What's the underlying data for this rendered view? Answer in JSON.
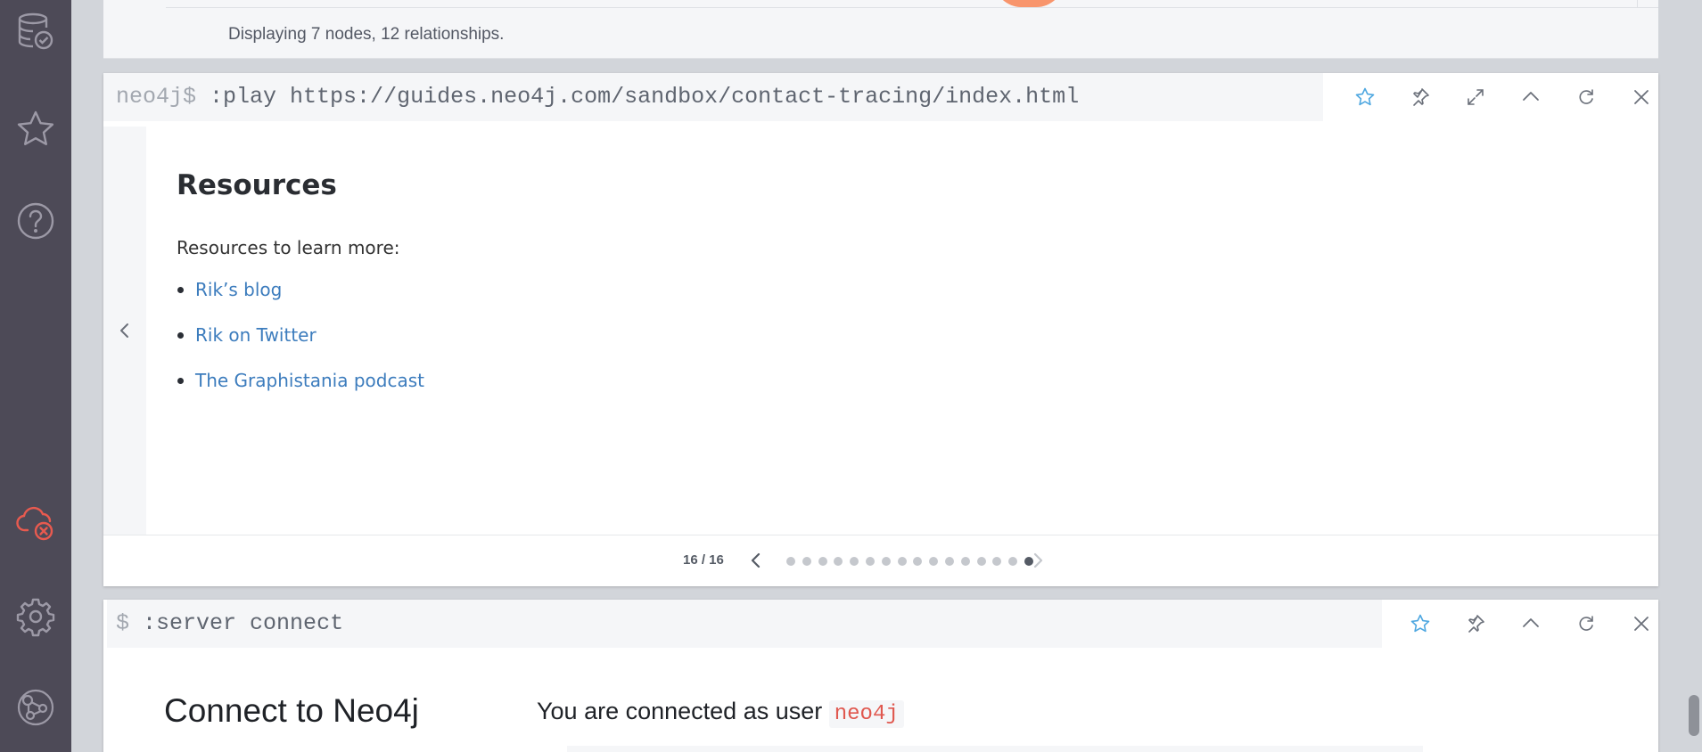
{
  "sidebar": {
    "items": [
      {
        "name": "database-icon"
      },
      {
        "name": "favorites-icon"
      },
      {
        "name": "help-icon"
      },
      {
        "name": "cloud-disconnected-icon"
      },
      {
        "name": "settings-icon"
      },
      {
        "name": "neo4j-browser-sync-icon"
      }
    ]
  },
  "top_frame": {
    "status": "Displaying 7 nodes, 12 relationships."
  },
  "play_frame": {
    "prompt": "neo4j$",
    "command": ":play https://guides.neo4j.com/sandbox/contact-tracing/index.html",
    "toolbar": [
      "star-icon",
      "pin-icon",
      "expand-icon",
      "collapse-icon",
      "rerun-icon",
      "close-icon"
    ],
    "guide": {
      "title": "Resources",
      "intro": "Resources to learn more:",
      "links": [
        "Rik’s blog",
        "Rik on Twitter",
        "The Graphistania podcast"
      ]
    },
    "pagination": {
      "counter": "16 / 16",
      "total": 16,
      "current": 16
    }
  },
  "connect_frame": {
    "prompt": "$",
    "command": ":server connect",
    "toolbar": [
      "star-icon",
      "pin-icon",
      "collapse-icon",
      "rerun-icon",
      "close-icon"
    ],
    "title": "Connect to Neo4j",
    "message": "You are connected as user",
    "user": "neo4j"
  },
  "colors": {
    "sidebar": "#4d4a57",
    "link": "#3c7cbd",
    "accent_star": "#4ea7e0",
    "alert": "#e0584f"
  }
}
